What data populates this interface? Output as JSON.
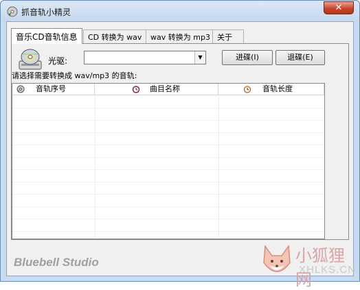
{
  "window": {
    "title": "抓音轨小精灵",
    "close_glyph": "✕"
  },
  "tabs": [
    {
      "label": "音乐CD音轨信息",
      "active": true
    },
    {
      "label": "CD 转换为 wav",
      "active": false
    },
    {
      "label": "wav 转换为 mp3",
      "active": false
    },
    {
      "label": "关于",
      "active": false
    }
  ],
  "panel": {
    "drive_label": "光驱:",
    "drive_value": "",
    "load_button": "进碟(I)",
    "eject_button": "退碟(E)",
    "prompt": "请选择需要转换成 wav/mp3 的音轨:"
  },
  "table": {
    "columns": [
      {
        "label": "音轨序号",
        "icon": "disc-icon"
      },
      {
        "label": "曲目名称",
        "icon": "alarm-clock-icon"
      },
      {
        "label": "音轨长度",
        "icon": "clock-icon"
      }
    ],
    "rows": []
  },
  "footer": {
    "brand": "Bluebell Studio"
  },
  "watermark": {
    "cn": "小狐狸网",
    "en": "XHLKS.CN"
  }
}
